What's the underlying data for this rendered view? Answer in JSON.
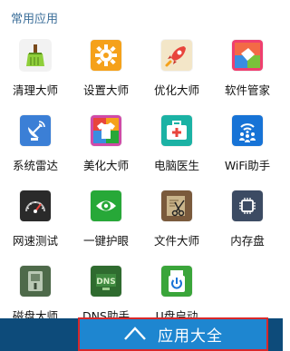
{
  "section": {
    "title": "常用应用"
  },
  "apps": [
    [
      {
        "label": "清理大师",
        "icon": "broom-icon",
        "color": "#f2f2f2"
      },
      {
        "label": "设置大师",
        "icon": "gear-icon",
        "color": "#f5a11a"
      },
      {
        "label": "优化大师",
        "icon": "rocket-icon",
        "color": "#f3e6c8"
      },
      {
        "label": "软件管家",
        "icon": "package-icon",
        "color": "#ef3f6f"
      }
    ],
    [
      {
        "label": "系统雷达",
        "icon": "radar-icon",
        "color": "#3b7fd6"
      },
      {
        "label": "美化大师",
        "icon": "tshirt-icon",
        "color": "#d04aa8"
      },
      {
        "label": "电脑医生",
        "icon": "medkit-icon",
        "color": "#1bb2a4"
      },
      {
        "label": "WiFi助手",
        "icon": "wifi-people-icon",
        "color": "#1773d6"
      }
    ],
    [
      {
        "label": "网速测试",
        "icon": "speedometer-icon",
        "color": "#2a2a2a"
      },
      {
        "label": "一键护眼",
        "icon": "eye-icon",
        "color": "#27a838"
      },
      {
        "label": "文件大师",
        "icon": "scissors-icon",
        "color": "#7a5a3c"
      },
      {
        "label": "内存盘",
        "icon": "chip-icon",
        "color": "#3c4b63"
      }
    ],
    [
      {
        "label": "磁盘大师",
        "icon": "disk-icon",
        "color": "#4e6a4a"
      },
      {
        "label": "DNS助手",
        "icon": "dns-icon",
        "color": "#2f6b2f"
      },
      {
        "label": "U盘启动",
        "icon": "usb-power-icon",
        "color": "#3aa53a"
      }
    ]
  ],
  "footer": {
    "button_label": "应用大全"
  }
}
